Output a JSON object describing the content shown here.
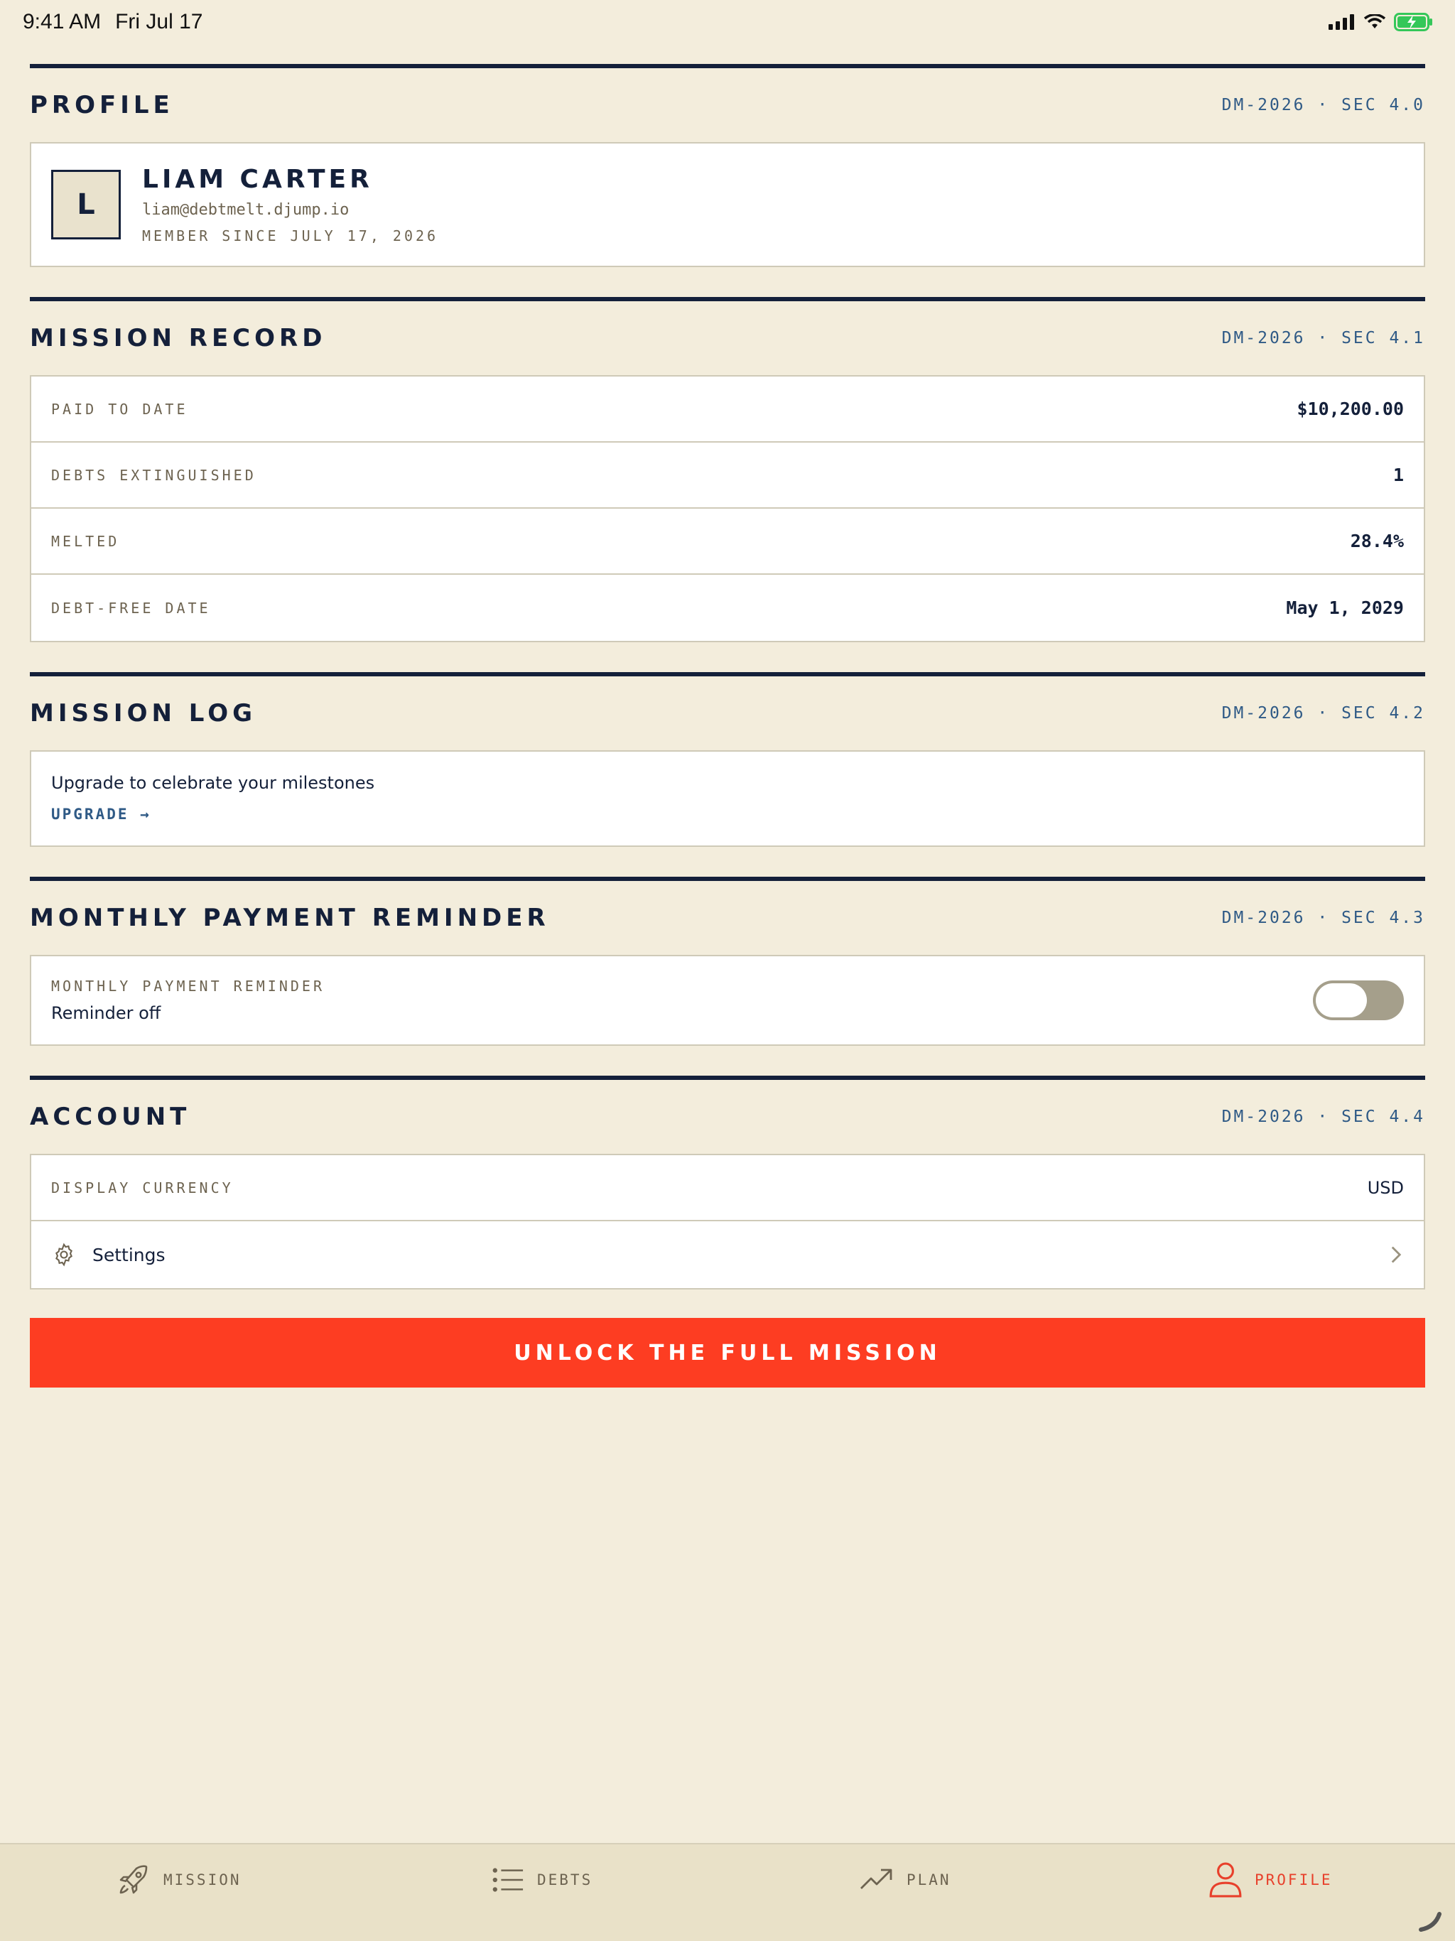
{
  "status_bar": {
    "time": "9:41 AM",
    "date": "Fri Jul 17"
  },
  "profile_section": {
    "title": "PROFILE",
    "code": "DM-2026 · SEC 4.0",
    "avatar_initial": "L",
    "name": "LIAM CARTER",
    "email": "liam@debtmelt.djump.io",
    "member_since": "MEMBER SINCE JULY 17, 2026"
  },
  "mission_record": {
    "title": "MISSION RECORD",
    "code": "DM-2026 · SEC 4.1",
    "rows": [
      {
        "label": "PAID TO DATE",
        "value": "$10,200.00"
      },
      {
        "label": "DEBTS EXTINGUISHED",
        "value": "1"
      },
      {
        "label": "MELTED",
        "value": "28.4%"
      },
      {
        "label": "DEBT-FREE DATE",
        "value": "May 1, 2029"
      }
    ]
  },
  "mission_log": {
    "title": "MISSION LOG",
    "code": "DM-2026 · SEC 4.2",
    "message": "Upgrade to celebrate your milestones",
    "link": "UPGRADE →"
  },
  "reminder": {
    "title": "MONTHLY PAYMENT REMINDER",
    "code": "DM-2026 · SEC 4.3",
    "label": "MONTHLY PAYMENT REMINDER",
    "status": "Reminder off",
    "enabled": false
  },
  "account": {
    "title": "ACCOUNT",
    "code": "DM-2026 · SEC 4.4",
    "currency_label": "DISPLAY CURRENCY",
    "currency_value": "USD",
    "settings_label": "Settings"
  },
  "cta": {
    "label": "UNLOCK THE FULL MISSION"
  },
  "tabs": [
    {
      "label": "MISSION",
      "icon": "rocket-icon",
      "active": false
    },
    {
      "label": "DEBTS",
      "icon": "list-icon",
      "active": false
    },
    {
      "label": "PLAN",
      "icon": "trend-up-icon",
      "active": false
    },
    {
      "label": "PROFILE",
      "icon": "person-icon",
      "active": true
    }
  ],
  "colors": {
    "background": "#f3eddc",
    "ink": "#14203a",
    "accent": "#fd3d22",
    "code_blue": "#2f5a86",
    "muted": "#6d6350"
  }
}
